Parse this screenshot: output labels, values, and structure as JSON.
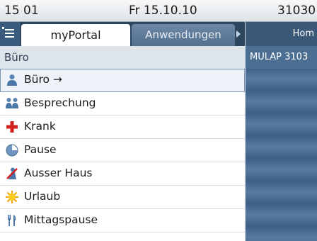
{
  "status_bar": {
    "time": "15 01",
    "date": "Fr 15.10.10",
    "extension": "31030"
  },
  "tabs": {
    "active_label": "myPortal",
    "inactive_label": "Anwendungen"
  },
  "group_header": "Büro",
  "status_items": [
    {
      "label": "Büro →",
      "icon": "person-icon"
    },
    {
      "label": "Besprechung",
      "icon": "meeting-icon"
    },
    {
      "label": "Krank",
      "icon": "red-cross-icon"
    },
    {
      "label": "Pause",
      "icon": "clock-icon"
    },
    {
      "label": "Ausser Haus",
      "icon": "out-of-office-icon"
    },
    {
      "label": "Urlaub",
      "icon": "sun-icon"
    },
    {
      "label": "Mittagspause",
      "icon": "cutlery-icon"
    }
  ],
  "right_panel": {
    "header": "Hom",
    "line": "MULAP 3103"
  },
  "colors": {
    "accent": "#3e5f85",
    "tab_bar": "#2d4660",
    "selected_outline": "#7b96b5"
  }
}
